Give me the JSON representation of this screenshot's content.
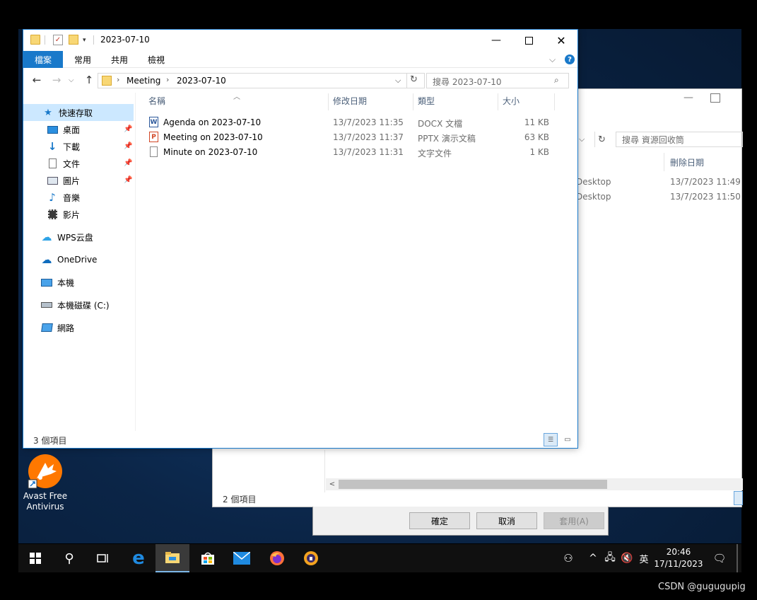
{
  "watermark": "CSDN @gugugupig",
  "desktop": {
    "avast_label_line1": "Avast Free",
    "avast_label_line2": "Antivirus"
  },
  "bin_window": {
    "search_placeholder": "搜尋 資源回收筒",
    "col_deleted": "刪除日期",
    "rows": [
      {
        "location": "Desktop",
        "deleted": "13/7/2023 11:49"
      },
      {
        "location": "Desktop",
        "deleted": "13/7/2023 11:50"
      }
    ],
    "status": "2 個項目"
  },
  "dialog": {
    "ok": "確定",
    "cancel": "取消",
    "apply": "套用(A)"
  },
  "explorer": {
    "title": "2023-07-10",
    "ribbon_tabs": [
      "檔案",
      "常用",
      "共用",
      "檢視"
    ],
    "breadcrumb": [
      "Meeting",
      "2023-07-10"
    ],
    "search_placeholder": "搜尋 2023-07-10",
    "nav": {
      "quick_access": "快速存取",
      "pinned": [
        "桌面",
        "下載",
        "文件",
        "圖片"
      ],
      "others": [
        "音樂",
        "影片"
      ],
      "wps": "WPS云盘",
      "onedrive": "OneDrive",
      "this_pc": "本機",
      "drive_c": "本機磁碟 (C:)",
      "network": "網路"
    },
    "columns": {
      "name": "名稱",
      "modified": "修改日期",
      "type": "類型",
      "size": "大小"
    },
    "files": [
      {
        "name": "Agenda on 2023-07-10",
        "modified": "13/7/2023 11:35",
        "type": "DOCX 文檔",
        "size": "11 KB",
        "icon": "docx-icon"
      },
      {
        "name": "Meeting on 2023-07-10",
        "modified": "13/7/2023 11:37",
        "type": "PPTX 演示文稿",
        "size": "63 KB",
        "icon": "pptx-icon"
      },
      {
        "name": "Minute on 2023-07-10",
        "modified": "13/7/2023 11:31",
        "type": "文字文件",
        "size": "1 KB",
        "icon": "txt-icon"
      }
    ],
    "status": "3 個項目"
  },
  "taskbar": {
    "time": "20:46",
    "date": "17/11/2023",
    "ime": "英"
  },
  "colors": {
    "accent": "#1979ca",
    "taskbar": "#101010",
    "desktop": "#0b2547"
  }
}
